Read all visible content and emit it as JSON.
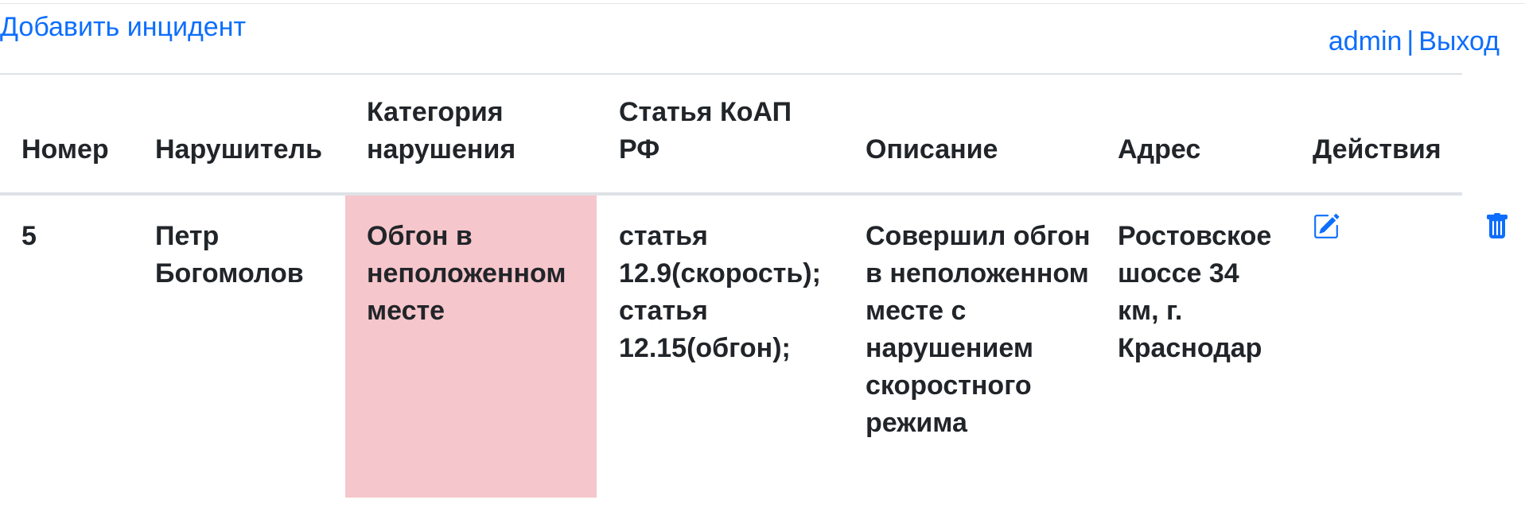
{
  "header": {
    "add_incident_link": "Добавить инцидент",
    "user_name": "admin",
    "separator": "|",
    "logout_link": "Выход"
  },
  "table": {
    "columns": [
      "Номер",
      "Нарушитель",
      "Категория нарушения",
      "Статья КоАП РФ",
      "Описание",
      "Адрес",
      "Действия"
    ],
    "rows": [
      {
        "number": "5",
        "offender": "Петр Богомолов",
        "category": "Обгон в неположенном месте",
        "articles": "статья 12.9(скорость); статья 12.15(обгон);",
        "description": "Совершил обгон в неположенном месте с нарушением скоростного режима",
        "address": "Ростовское шоссе 34 км, г. Краснодар",
        "actions": {
          "edit_icon": "edit-icon",
          "delete_icon": "trash-icon"
        }
      }
    ]
  },
  "colors": {
    "link": "#0d6efd",
    "category_highlight": "#f5c6cb",
    "border": "#dee2e6"
  }
}
